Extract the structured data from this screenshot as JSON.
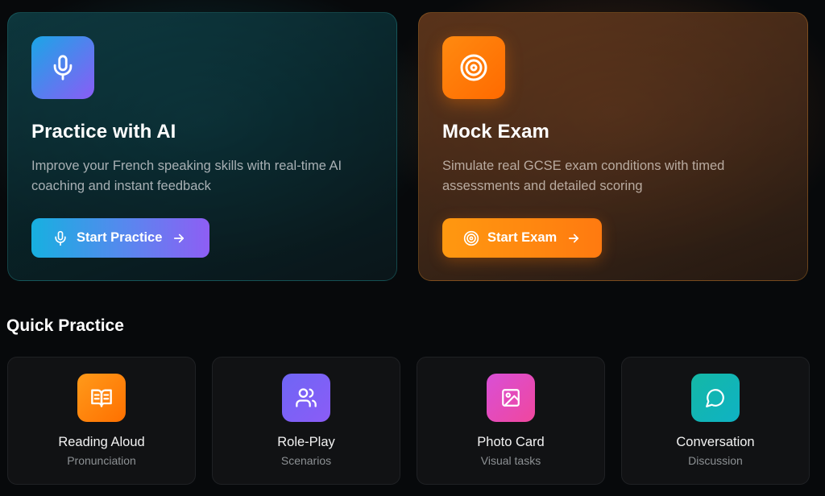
{
  "hero_cards": {
    "practice": {
      "icon": "microphone-icon",
      "title": "Practice with AI",
      "description": "Improve your French speaking skills with real-time AI coaching and instant feedback",
      "button_label": "Start Practice",
      "gradient": [
        "#1aa6e6",
        "#8a5cf6"
      ]
    },
    "exam": {
      "icon": "target-icon",
      "title": "Mock Exam",
      "description": "Simulate real GCSE exam conditions with timed assessments and detailed scoring",
      "button_label": "Start Exam",
      "gradient": [
        "#ff8a10",
        "#ff6a00"
      ]
    }
  },
  "quick_practice": {
    "title": "Quick Practice",
    "items": [
      {
        "label": "Reading Aloud",
        "sub": "Pronunciation",
        "icon": "book-open-icon",
        "color": "#ff8a10"
      },
      {
        "label": "Role-Play",
        "sub": "Scenarios",
        "icon": "users-icon",
        "color": "#7b5cf6"
      },
      {
        "label": "Photo Card",
        "sub": "Visual tasks",
        "icon": "image-icon",
        "color": "#e64fbf"
      },
      {
        "label": "Conversation",
        "sub": "Discussion",
        "icon": "chat-bubble-icon",
        "color": "#14b8b0"
      }
    ]
  }
}
